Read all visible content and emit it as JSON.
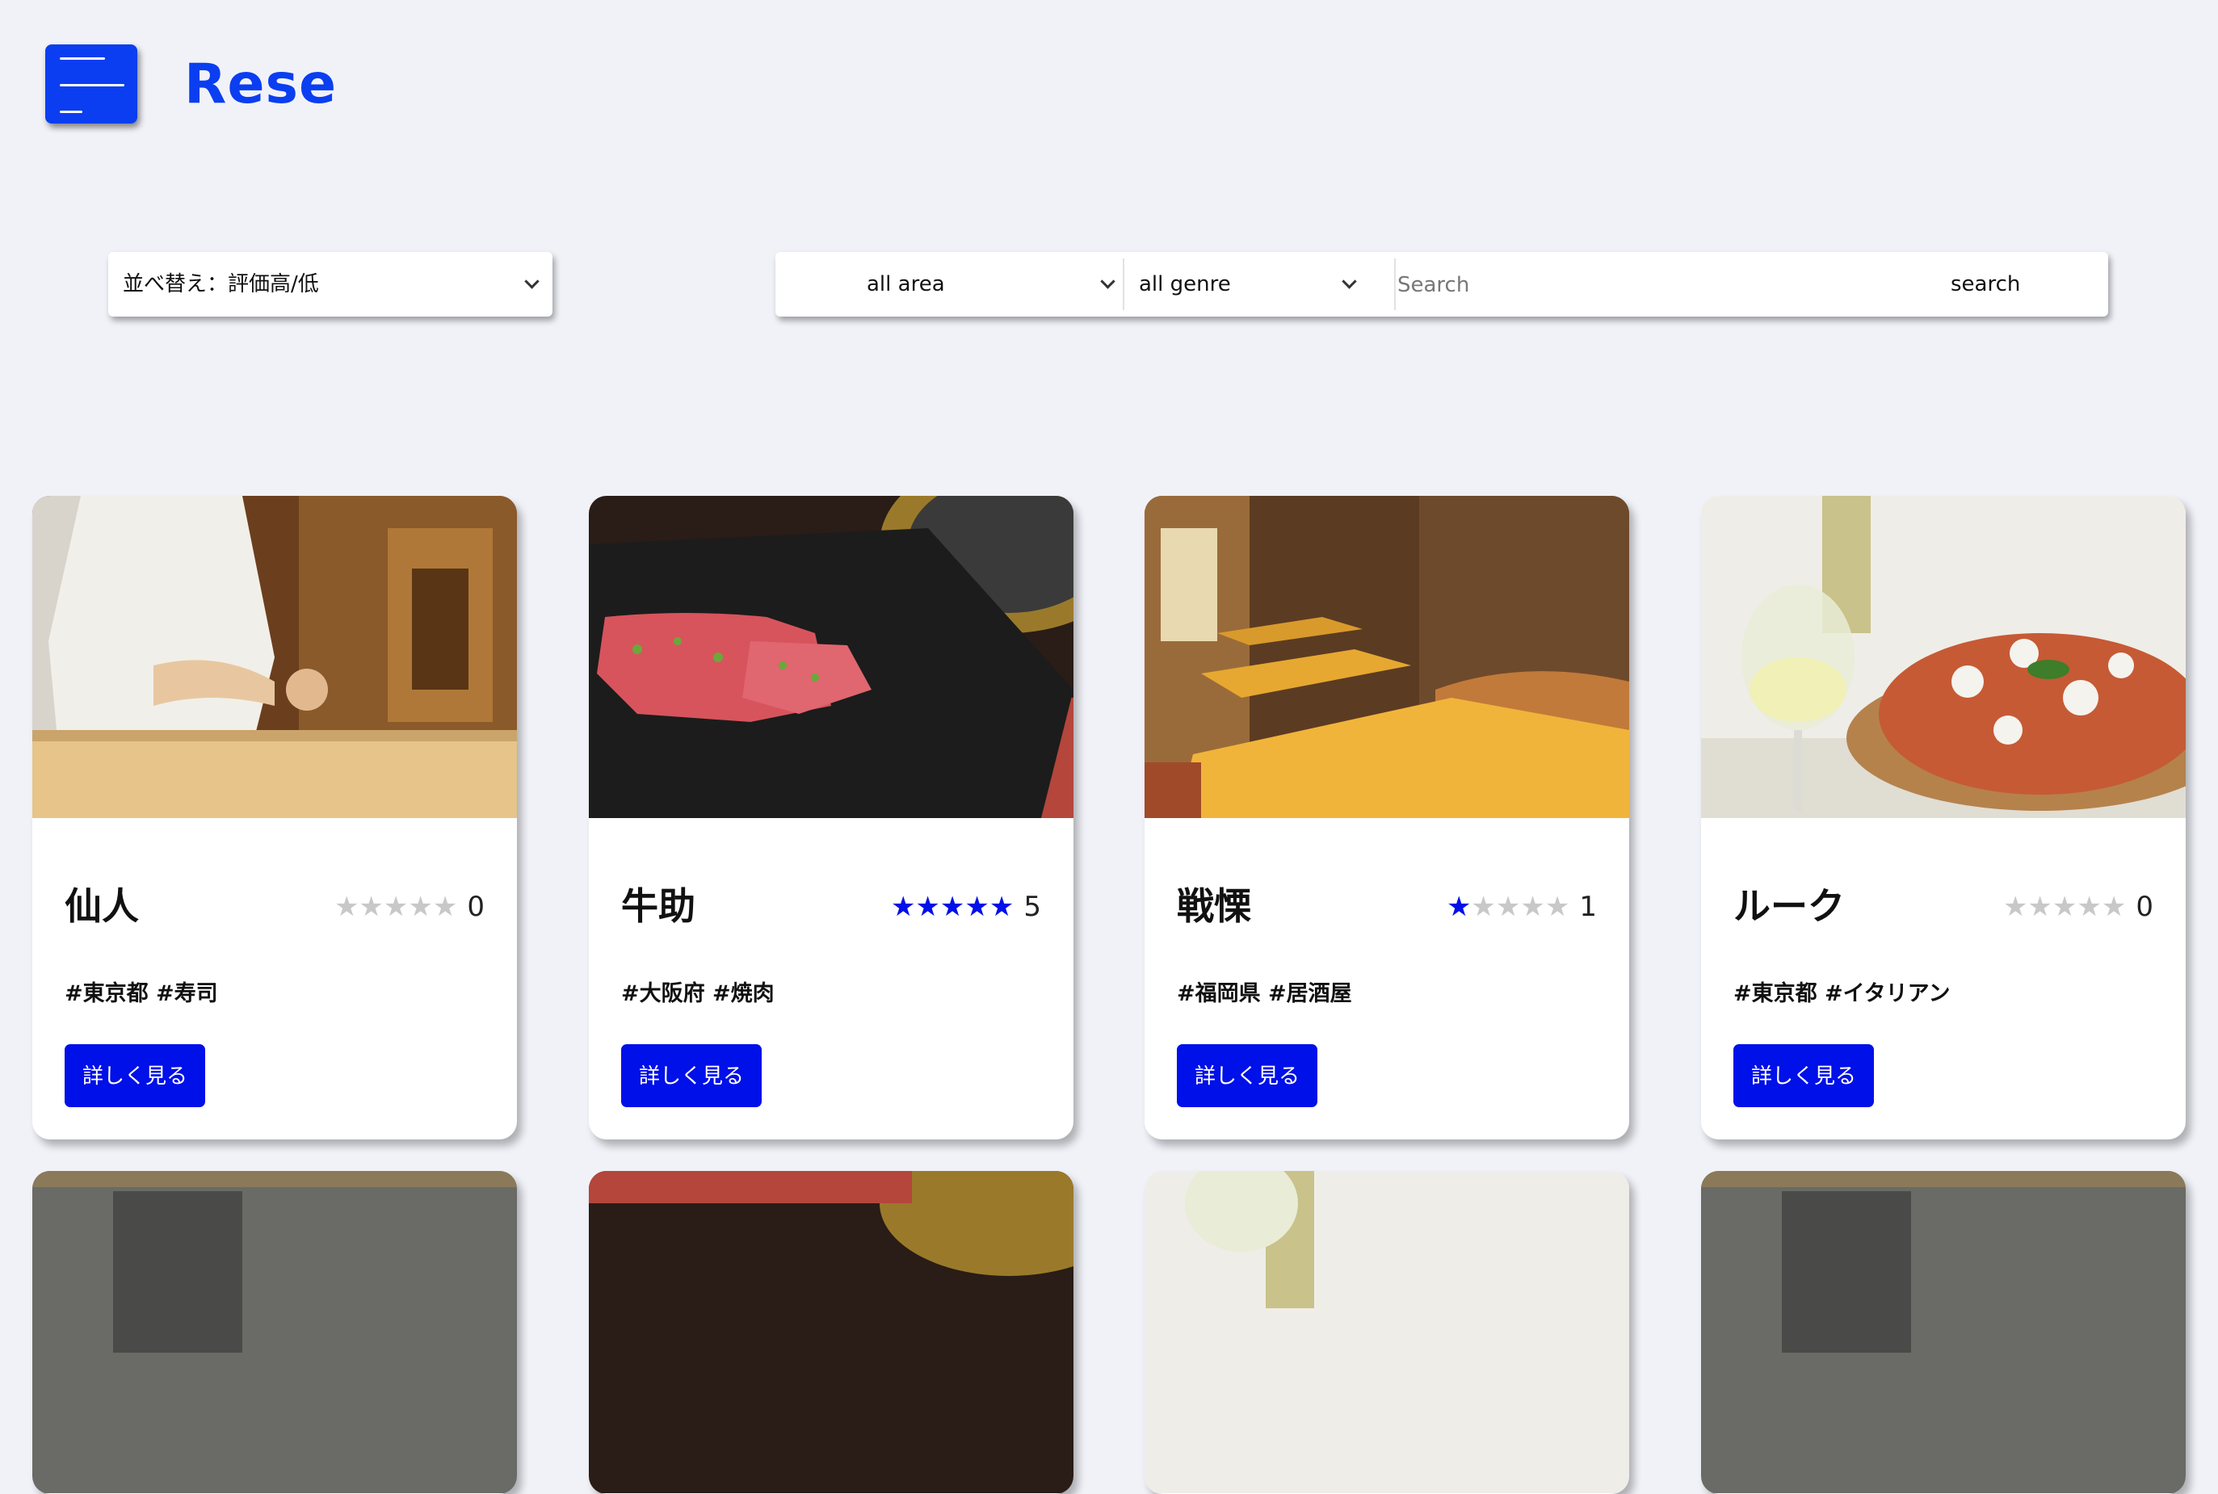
{
  "header": {
    "logo": "Rese",
    "menu_icon": "hamburger-menu-icon"
  },
  "sort": {
    "label": "並べ替え：評価高/低"
  },
  "search": {
    "area": "all area",
    "genre": "all genre",
    "input_placeholder": "Search",
    "input_value": "",
    "button_label": "search"
  },
  "colors": {
    "accent": "#0a3ef0",
    "button": "#0010e8",
    "background": "#f1f2f8"
  },
  "shops": [
    {
      "name": "仙人",
      "rating": 0,
      "rating_text": "0",
      "tags": "#東京都 #寿司",
      "button_label": "詳しく見る"
    },
    {
      "name": "牛助",
      "rating": 5,
      "rating_text": "5",
      "tags": "#大阪府 #焼肉",
      "button_label": "詳しく見る"
    },
    {
      "name": "戦慄",
      "rating": 1,
      "rating_text": "1",
      "tags": "#福岡県 #居酒屋",
      "button_label": "詳しく見る"
    },
    {
      "name": "ルーク",
      "rating": 0,
      "rating_text": "0",
      "tags": "#東京都 #イタリアン",
      "button_label": "詳しく見る"
    }
  ]
}
